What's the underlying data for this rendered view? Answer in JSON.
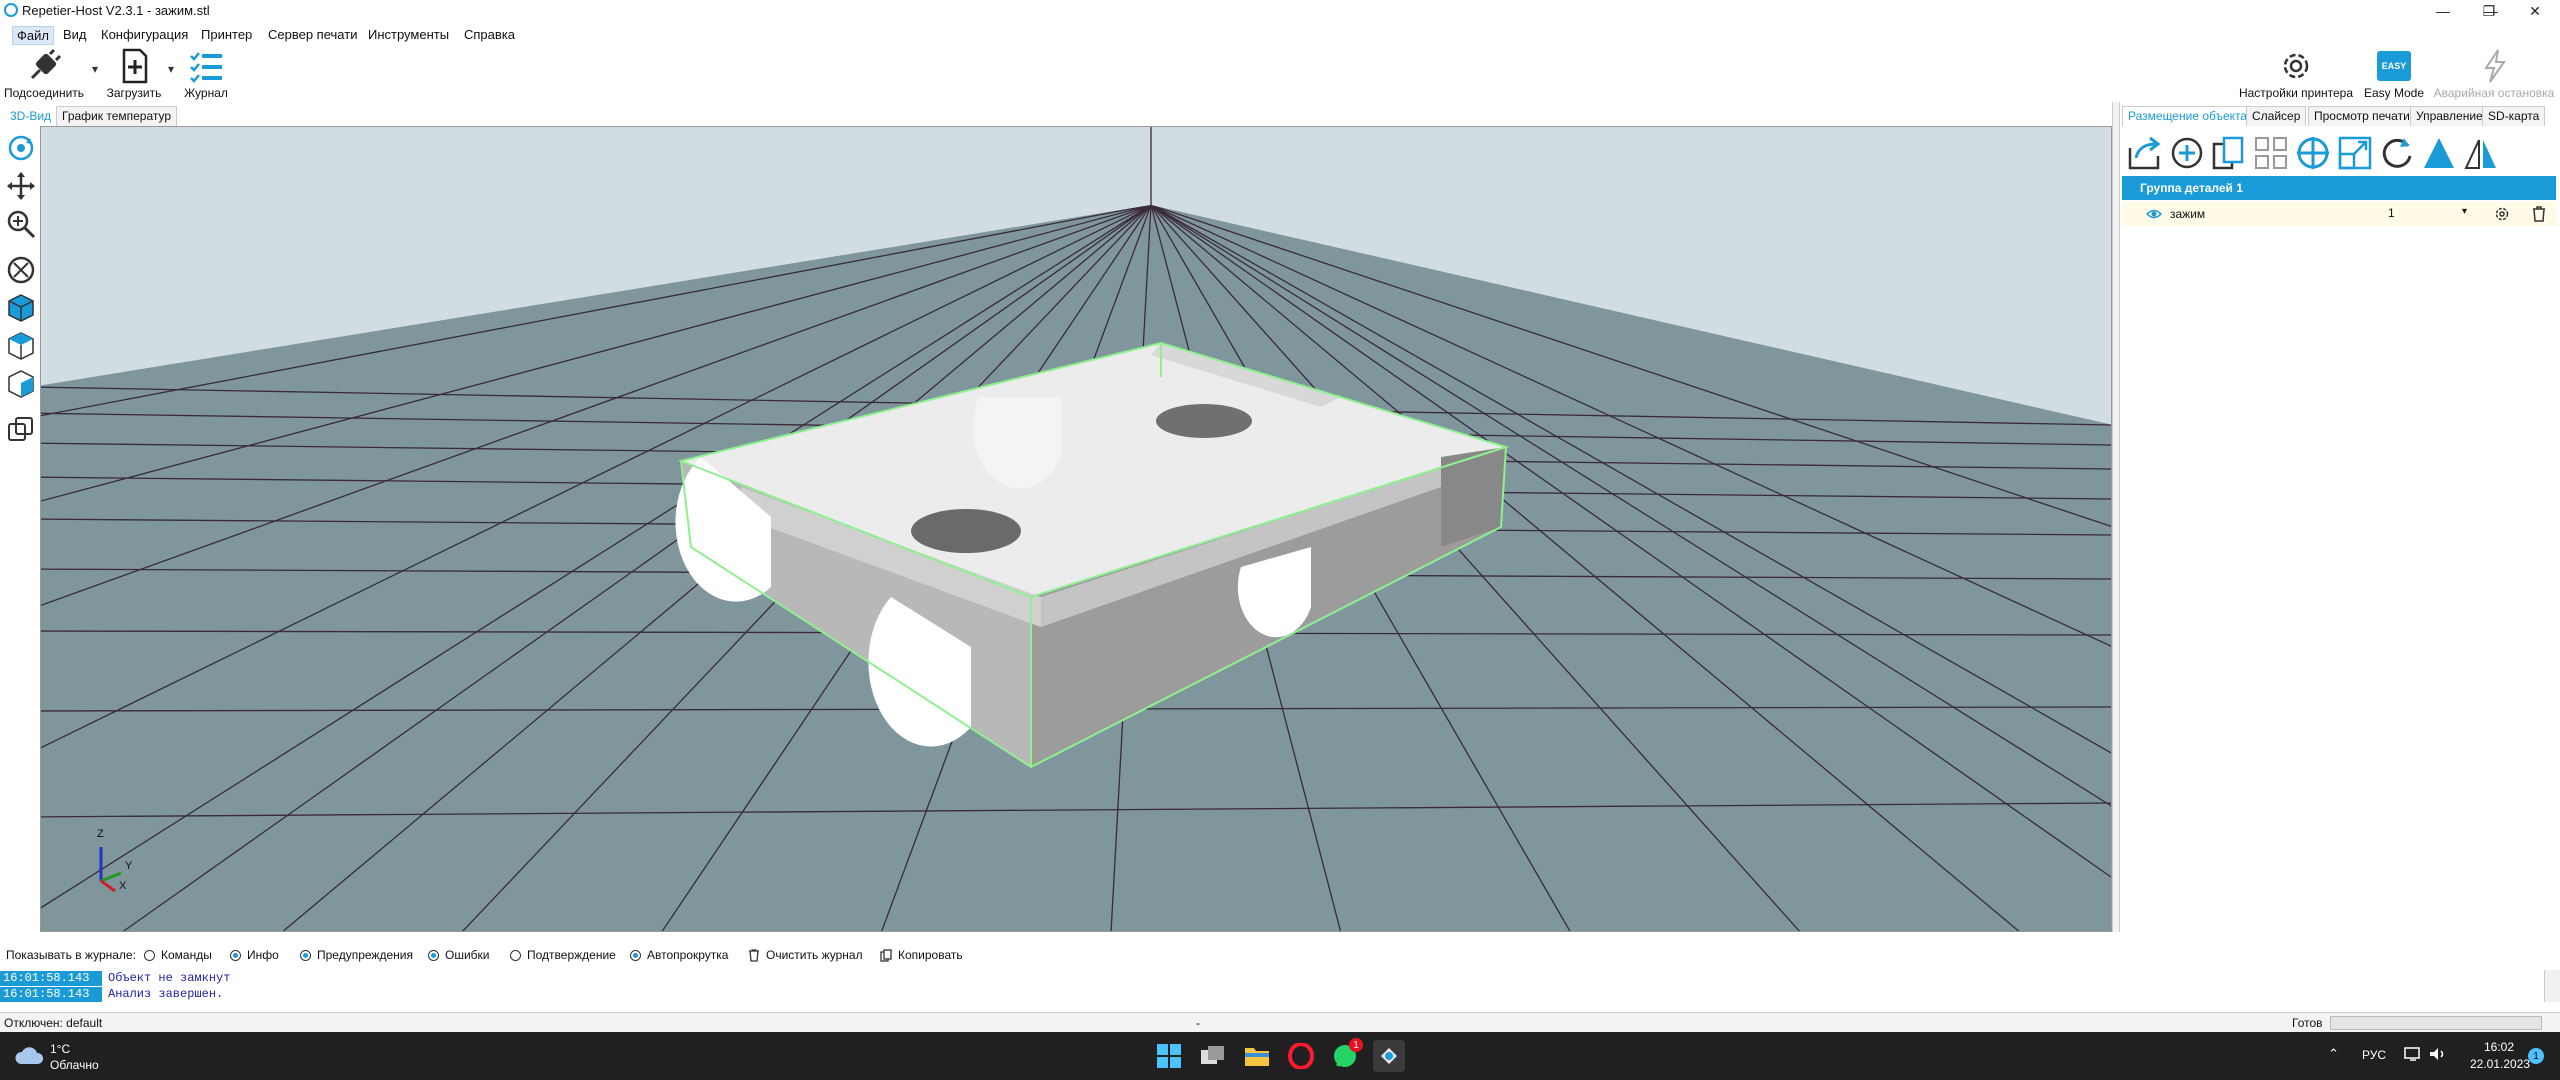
{
  "window": {
    "title": "Repetier-Host V2.3.1 - зажим.stl",
    "controls": {
      "minimize": "—",
      "restore": "❐",
      "close": "✕"
    }
  },
  "menu": [
    "Файл",
    "Вид",
    "Конфигурация",
    "Принтер",
    "Сервер печати",
    "Инструменты",
    "Справка"
  ],
  "toolbar": {
    "connect": "Подсоединить",
    "load": "Загрузить",
    "log": "Журнал",
    "printer_settings": "Настройки принтера",
    "easy_mode": "Easy Mode",
    "easy_badge": "EASY",
    "emergency_stop": "Аварийная остановка"
  },
  "left_tabs": [
    "3D-Вид",
    "График температур"
  ],
  "right_tabs": [
    "Размещение объекта",
    "Слайсер",
    "Просмотр печати",
    "Управление",
    "SD-карта"
  ],
  "right_icons": [
    "export-icon",
    "add-icon",
    "copy-icon",
    "autoposition-icon",
    "center-icon",
    "scale-icon",
    "rotate-icon",
    "cut-icon",
    "mirror-icon"
  ],
  "group": {
    "title": "Группа деталей 1",
    "object": {
      "name": "зажим",
      "copies": "1"
    }
  },
  "log_options": {
    "prefix": "Показывать в журнале:",
    "items": [
      {
        "label": "Команды",
        "checked": false
      },
      {
        "label": "Инфо",
        "checked": true
      },
      {
        "label": "Предупреждения",
        "checked": true
      },
      {
        "label": "Ошибки",
        "checked": true
      },
      {
        "label": "Подтверждение",
        "checked": false
      },
      {
        "label": "Автопрокрутка",
        "checked": true
      }
    ],
    "clear": "Очистить журнал",
    "copy": "Копировать"
  },
  "log_lines": [
    {
      "time": "16:01:58.143",
      "msg": "Объект не замкнут"
    },
    {
      "time": "16:01:58.143",
      "msg": "Анализ завершен."
    }
  ],
  "status": {
    "left": "Отключен: default",
    "center": "-",
    "right": "Готов"
  },
  "axes": {
    "z": "Z",
    "y": "Y",
    "x": "X"
  },
  "taskbar": {
    "weather_temp": "1°C",
    "weather_desc": "Облачно",
    "lang": "РУС",
    "time": "16:02",
    "date": "22.01.2023",
    "whatsapp_badge": "1",
    "notif_count": "1"
  },
  "colors": {
    "accent": "#1a9bd7",
    "bed": "#7f969c",
    "grid": "#3a2a3a",
    "bbox": "#8ff08f"
  }
}
